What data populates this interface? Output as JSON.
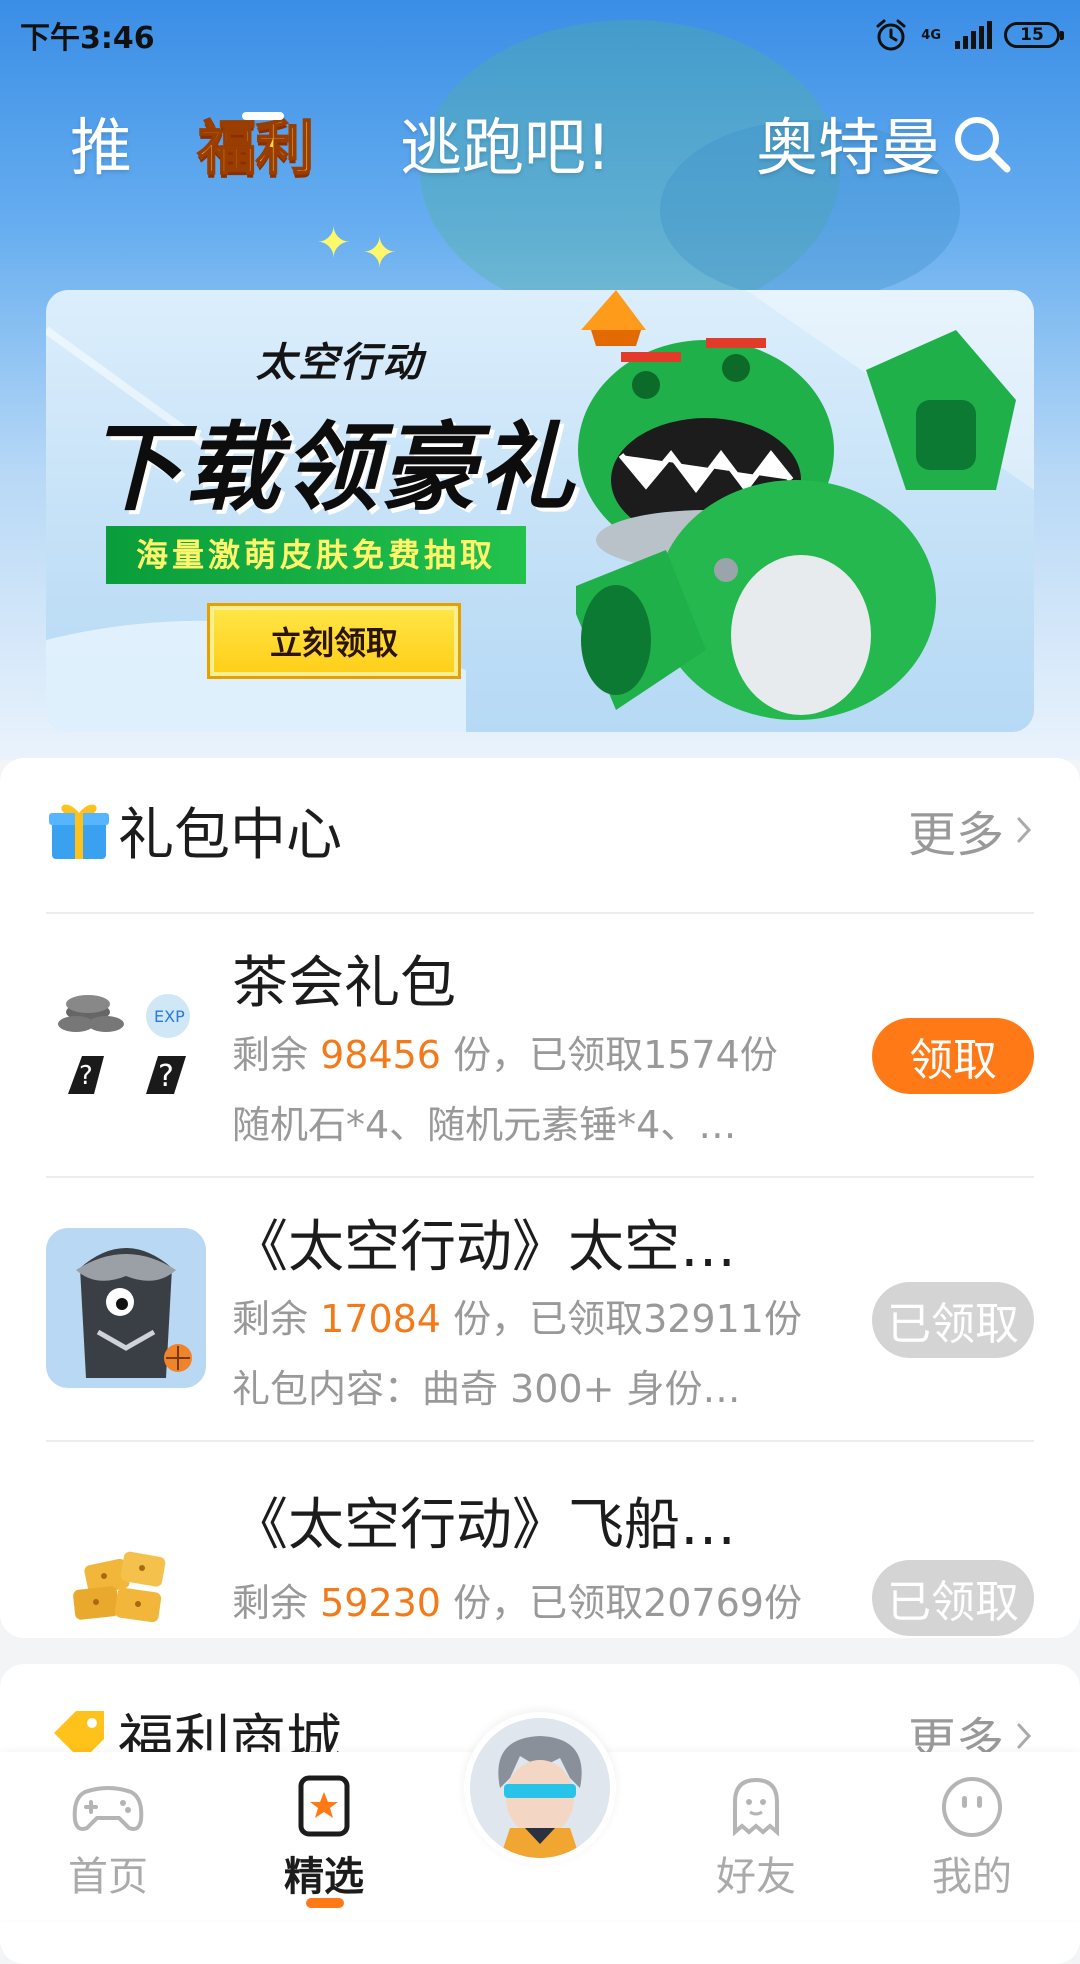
{
  "status_bar": {
    "time": "下午3:46",
    "network": "4G",
    "battery": "15"
  },
  "top_tabs": [
    {
      "label": "推"
    },
    {
      "label": "福利"
    },
    {
      "label": "逃跑吧!"
    },
    {
      "label": "奥特曼"
    }
  ],
  "colors": {
    "accent": "#ff7a16",
    "highlight_number": "#f27a1a",
    "claimed_button": "#d4d4d4",
    "sky_top": "#3a8ee6"
  },
  "banner": {
    "logo": "太空行动",
    "headline": "下载领豪礼",
    "subtitle": "海量激萌皮肤免费抽取",
    "button_label": "立刻领取"
  },
  "gift_center": {
    "title": "礼包中心",
    "more_label": "更多",
    "items": [
      {
        "name": "茶会礼包",
        "remain_prefix": "剩余 ",
        "remain": "98456",
        "remain_suffix": " 份，已领取1574份",
        "desc": "随机石*4、随机元素锤*4、…",
        "button": "领取",
        "state": "available"
      },
      {
        "name": "《太空行动》太空…",
        "remain_prefix": "剩余 ",
        "remain": "17084",
        "remain_suffix": " 份，已领取32911份",
        "desc": "礼包内容：曲奇 300+ 身份…",
        "button": "已领取",
        "state": "claimed"
      },
      {
        "name": "《太空行动》飞船…",
        "remain_prefix": "剩余 ",
        "remain": "59230",
        "remain_suffix": " 份，已领取20769份",
        "desc": "",
        "button": "已领取",
        "state": "claimed"
      }
    ]
  },
  "welfare_shop": {
    "title": "福利商城",
    "more_label": "更多"
  },
  "bottom_nav": [
    {
      "label": "首页",
      "icon": "gamepad-icon"
    },
    {
      "label": "精选",
      "icon": "bookmark-star-icon"
    },
    {
      "label": "",
      "icon": "avatar-icon"
    },
    {
      "label": "好友",
      "icon": "ghost-icon"
    },
    {
      "label": "我的",
      "icon": "smiley-icon"
    }
  ]
}
